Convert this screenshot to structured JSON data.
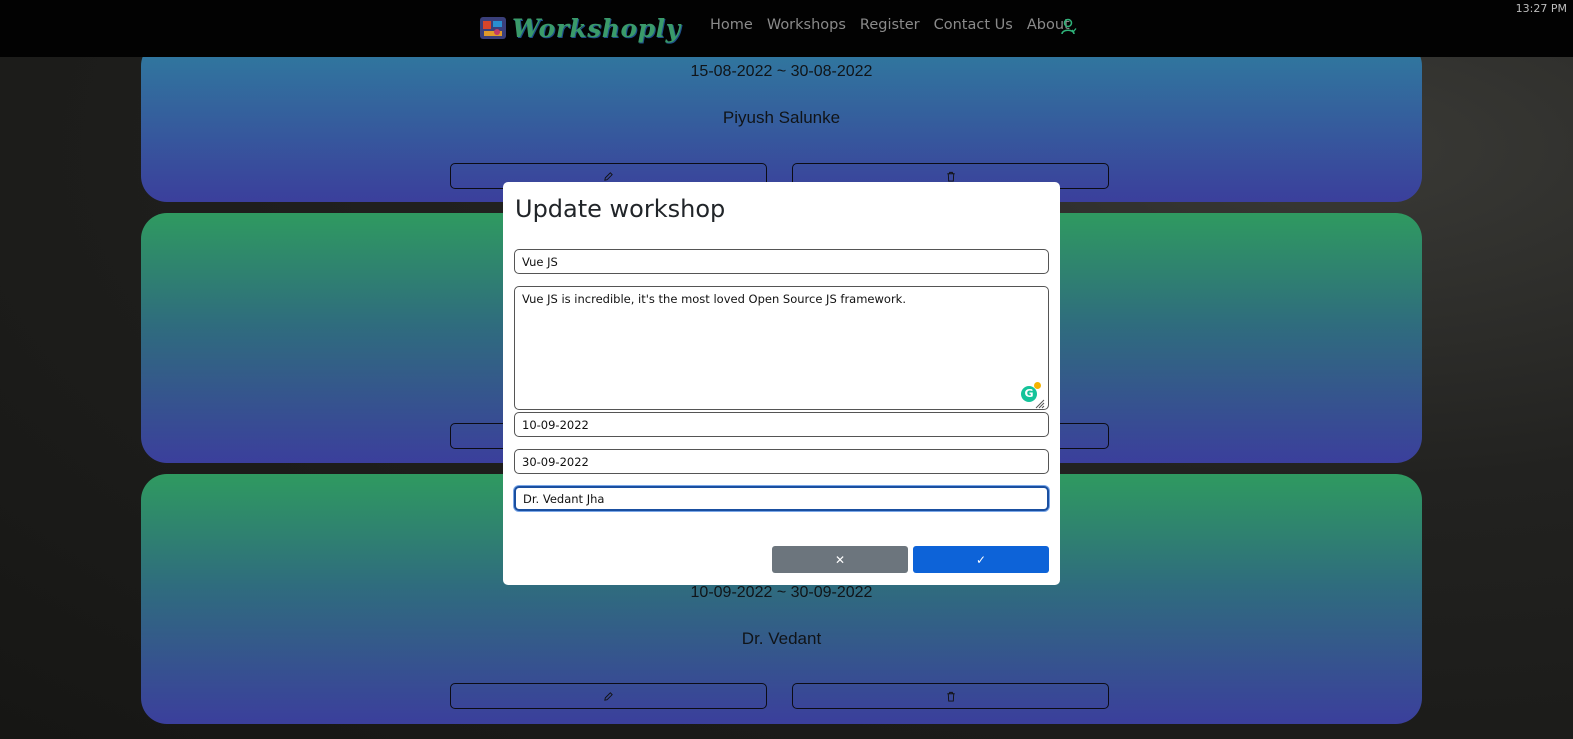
{
  "app": {
    "brand": "Workshoply"
  },
  "clock": "13:27 PM",
  "nav": {
    "items": [
      "Home",
      "Workshops",
      "Register",
      "Contact Us",
      "About"
    ]
  },
  "cards": [
    {
      "dates": "15-08-2022 ~ 30-08-2022",
      "instructor": "Piyush Salunke"
    },
    {
      "dates": "",
      "instructor": ""
    },
    {
      "dates": "10-09-2022 ~ 30-09-2022",
      "instructor": "Dr. Vedant"
    }
  ],
  "modal": {
    "title": "Update workshop",
    "name": "Vue JS",
    "description": "Vue JS is incredible, it's the most loved Open Source JS framework.",
    "start_date": "10-09-2022",
    "end_date": "30-09-2022",
    "instructor": "Dr. Vedant Jha",
    "cancel_icon": "✕",
    "confirm_icon": "✓"
  },
  "grammarly": {
    "label": "G",
    "badge_count": "1"
  },
  "icons": {
    "user": "user-icon",
    "edit": "pencil-icon",
    "delete": "trash-icon"
  },
  "colors": {
    "primary": "#0d63d8",
    "secondary": "#6c757d",
    "brand": "#3a9a6a"
  }
}
